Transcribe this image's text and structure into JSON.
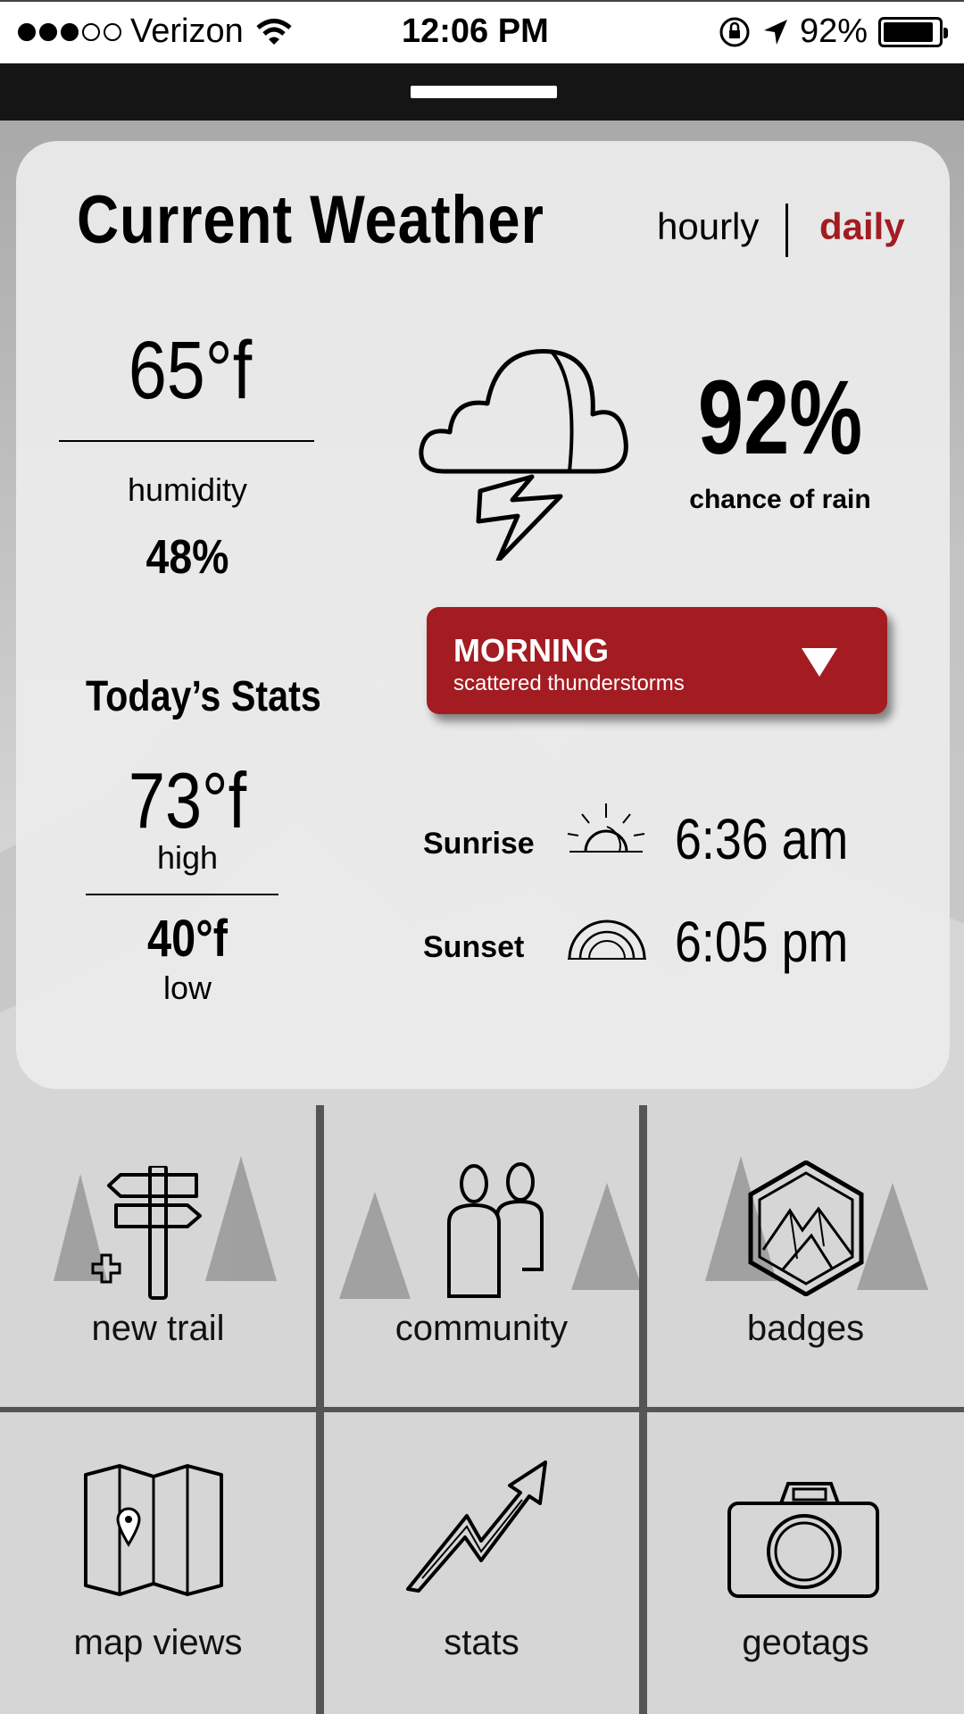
{
  "status_bar": {
    "carrier": "Verizon",
    "time": "12:06 PM",
    "battery_pct": "92%",
    "signal_dots_filled": 3,
    "signal_dots_total": 5
  },
  "weather": {
    "title": "Current Weather",
    "tabs": {
      "hourly": "hourly",
      "daily": "daily",
      "active": "daily"
    },
    "current_temp": "65°f",
    "humidity_label": "humidity",
    "humidity_value": "48%",
    "rain_chance_value": "92%",
    "rain_chance_label": "chance of rain",
    "forecast_select": {
      "title": "MORNING",
      "subtitle": "scattered thunderstorms"
    },
    "stats_title": "Today’s Stats",
    "high_temp": "73°f",
    "high_label": "high",
    "low_temp": "40°f",
    "low_label": "low",
    "sunrise_label": "Sunrise",
    "sunrise_time": "6:36 am",
    "sunset_label": "Sunset",
    "sunset_time": "6:05 pm",
    "accent_color": "#a31c22"
  },
  "tiles": [
    {
      "label": "new trail",
      "icon": "signpost-icon"
    },
    {
      "label": "community",
      "icon": "people-icon"
    },
    {
      "label": "badges",
      "icon": "badge-hexagon-icon"
    },
    {
      "label": "map views",
      "icon": "map-icon"
    },
    {
      "label": "stats",
      "icon": "trend-arrow-icon"
    },
    {
      "label": "geotags",
      "icon": "camera-icon"
    }
  ]
}
